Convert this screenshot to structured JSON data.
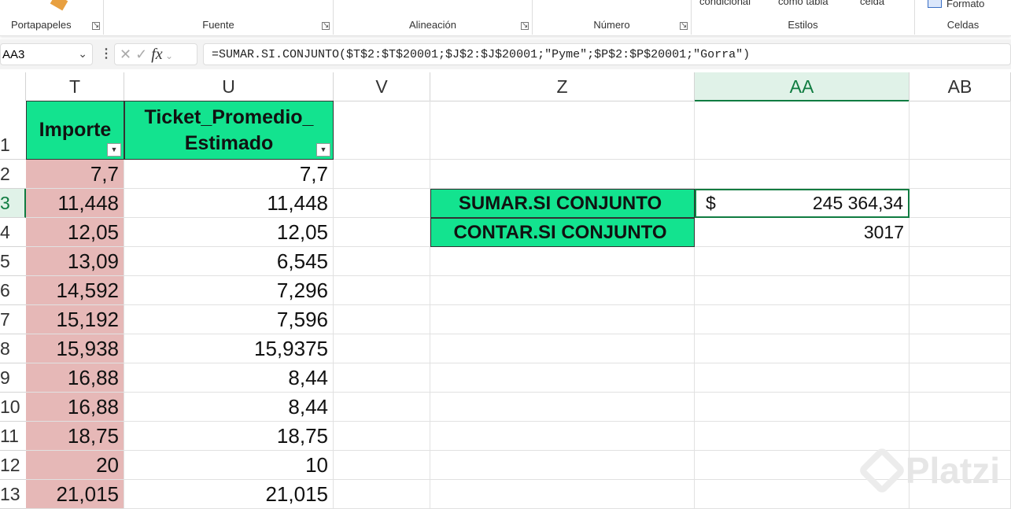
{
  "ribbon": {
    "groups": [
      "Portapapeles",
      "Fuente",
      "Alineación",
      "Número",
      "Estilos",
      "Celdas"
    ],
    "cut_labels": [
      "condicional",
      "como tabla",
      "celda",
      "Formato"
    ]
  },
  "formula_bar": {
    "name_box": "AA3",
    "fx": "fx",
    "formula": "=SUMAR.SI.CONJUNTO($T$2:$T$20001;$J$2:$J$20001;\"Pyme\";$P$2:$P$20001;\"Gorra\")"
  },
  "columns": [
    "T",
    "U",
    "V",
    "Z",
    "AA",
    "AB"
  ],
  "rows": [
    "1",
    "2",
    "3",
    "4",
    "5",
    "6",
    "7",
    "8",
    "9",
    "10",
    "11",
    "12",
    "13"
  ],
  "table": {
    "headers": [
      "Importe",
      "Ticket_Promedio_ Estimado"
    ],
    "importe": [
      "7,7",
      "11,448",
      "12,05",
      "13,09",
      "14,592",
      "15,192",
      "15,938",
      "16,88",
      "16,88",
      "18,75",
      "20",
      "21,015"
    ],
    "ticket": [
      "7,7",
      "11,448",
      "12,05",
      "6,545",
      "7,296",
      "7,596",
      "15,9375",
      "8,44",
      "8,44",
      "18,75",
      "10",
      "21,015"
    ]
  },
  "summary": {
    "sumar_label": "SUMAR.SI CONJUNTO",
    "sumar_currency": "$",
    "sumar_value": "245 364,34",
    "contar_label": "CONTAR.SI CONJUNTO",
    "contar_value": "3017"
  },
  "watermark": "Platzi"
}
